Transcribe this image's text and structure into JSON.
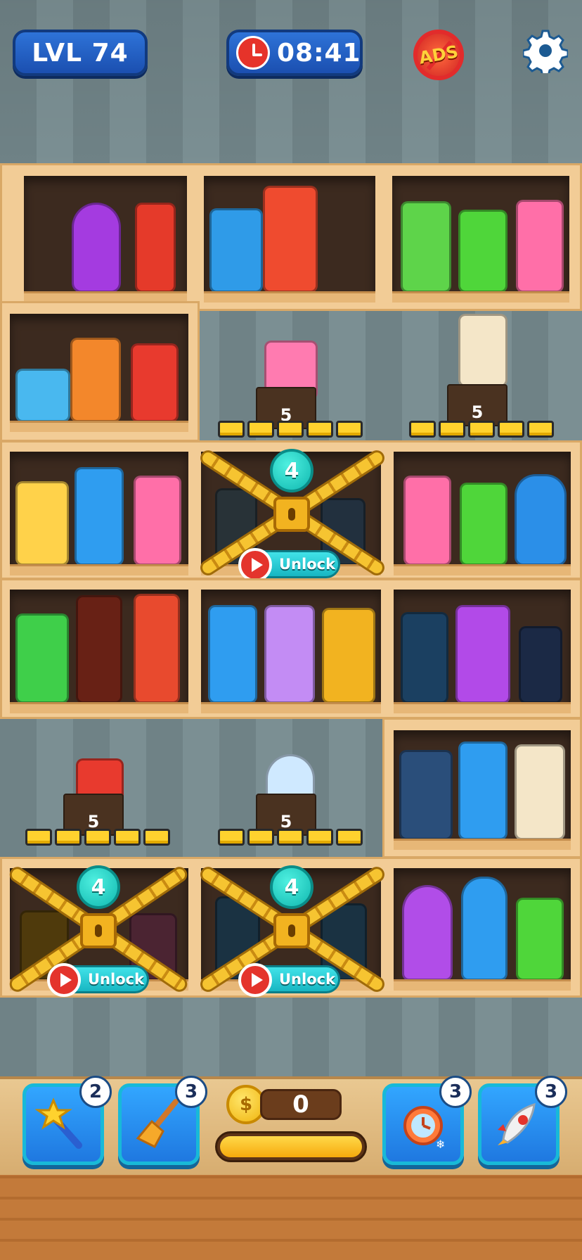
{
  "hud": {
    "level_label": "LVL 74",
    "timer": "08:41",
    "ads_label": "ADS",
    "icons": [
      "alarm-clock-icon",
      "no-ads-icon",
      "gear-icon"
    ]
  },
  "shelves": {
    "counters": [
      "5",
      "5",
      "5",
      "5"
    ],
    "locks": [
      {
        "count": "4",
        "button": "Unlock"
      },
      {
        "count": "4",
        "button": "Unlock"
      },
      {
        "count": "4",
        "button": "Unlock"
      }
    ]
  },
  "bottom": {
    "coins": "0",
    "coin_symbol": "$",
    "boosters": [
      {
        "name": "magic-wand",
        "count": "2"
      },
      {
        "name": "broom",
        "count": "3"
      },
      {
        "name": "freeze-clock",
        "count": "3"
      },
      {
        "name": "rocket",
        "count": "3"
      }
    ],
    "progress": 1.0
  },
  "colors": {
    "hud_pill": "#2e73d8",
    "lock_gold": "#f6c431",
    "unlock_cyan": "#41e2e8",
    "shelf_wood": "#f2cc96"
  }
}
